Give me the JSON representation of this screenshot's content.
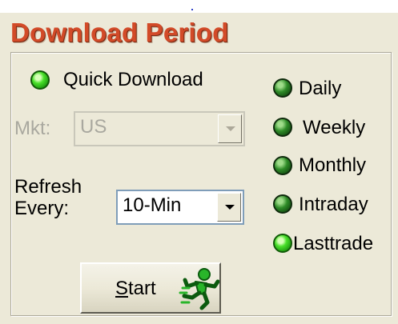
{
  "title": "Download Period",
  "quick_download": {
    "label": "Quick Download",
    "state": "on"
  },
  "market": {
    "label": "Mkt:",
    "value": "US",
    "enabled": false
  },
  "refresh": {
    "label_line1": "Refresh",
    "label_line2": "Every:",
    "value": "10-Min"
  },
  "start_button": {
    "label_underlined": "S",
    "label_rest": "tart",
    "icon": "running-man-icon"
  },
  "periods": [
    {
      "label": "Daily",
      "state": "dim"
    },
    {
      "label": "Weekly",
      "state": "dim"
    },
    {
      "label": "Monthly",
      "state": "dim"
    },
    {
      "label": "Intraday",
      "state": "dim"
    },
    {
      "label": "Lasttrade",
      "state": "on"
    }
  ],
  "colors": {
    "title": "#d24a28",
    "led_on": "#49e02a",
    "led_dim": "#2f8c28",
    "panel": "#ece9d8"
  }
}
